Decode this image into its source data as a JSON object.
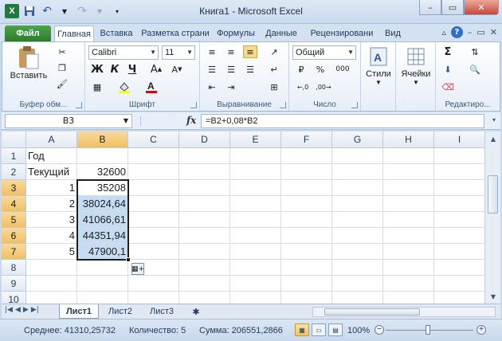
{
  "window": {
    "title": "Книга1 - Microsoft Excel"
  },
  "ribbon_tabs": [
    {
      "label": "Файл"
    },
    {
      "label": "Главная"
    },
    {
      "label": "Вставка"
    },
    {
      "label": "Разметка страни"
    },
    {
      "label": "Формулы"
    },
    {
      "label": "Данные"
    },
    {
      "label": "Рецензировани"
    },
    {
      "label": "Вид"
    }
  ],
  "ribbon": {
    "clipboard": {
      "paste_label": "Вставить",
      "group_label": "Буфер обм..."
    },
    "font": {
      "name": "Calibri",
      "size": "11",
      "bold": "Ж",
      "italic": "К",
      "underline": "Ч",
      "group_label": "Шрифт"
    },
    "alignment": {
      "group_label": "Выравнивание"
    },
    "number": {
      "format": "Общий",
      "group_label": "Число",
      "currency": "%",
      "thousands": "000"
    },
    "styles": {
      "label": "Стили"
    },
    "cells": {
      "label": "Ячейки"
    },
    "editing": {
      "group_label": "Редактиро..."
    }
  },
  "formula_bar": {
    "name_box": "B3",
    "fx": "fx",
    "formula": "=B2+0,08*B2"
  },
  "columns": [
    "A",
    "B",
    "C",
    "D",
    "E",
    "F",
    "G",
    "H",
    "I"
  ],
  "rows": [
    "1",
    "2",
    "3",
    "4",
    "5",
    "6",
    "7",
    "8",
    "9",
    "10"
  ],
  "cells": {
    "A1": "Год",
    "A2": "Текущий",
    "B2": "32600",
    "A3": "1",
    "B3": "35208",
    "A4": "2",
    "B4": "38024,64",
    "A5": "3",
    "B5": "41066,61",
    "A6": "4",
    "B6": "44351,94",
    "A7": "5",
    "B7": "47900,1"
  },
  "sheets": [
    {
      "label": "Лист1"
    },
    {
      "label": "Лист2"
    },
    {
      "label": "Лист3"
    }
  ],
  "status": {
    "average": "Среднее: 41310,25732",
    "count": "Количество: 5",
    "sum": "Сумма: 206551,2866",
    "zoom": "100%"
  }
}
